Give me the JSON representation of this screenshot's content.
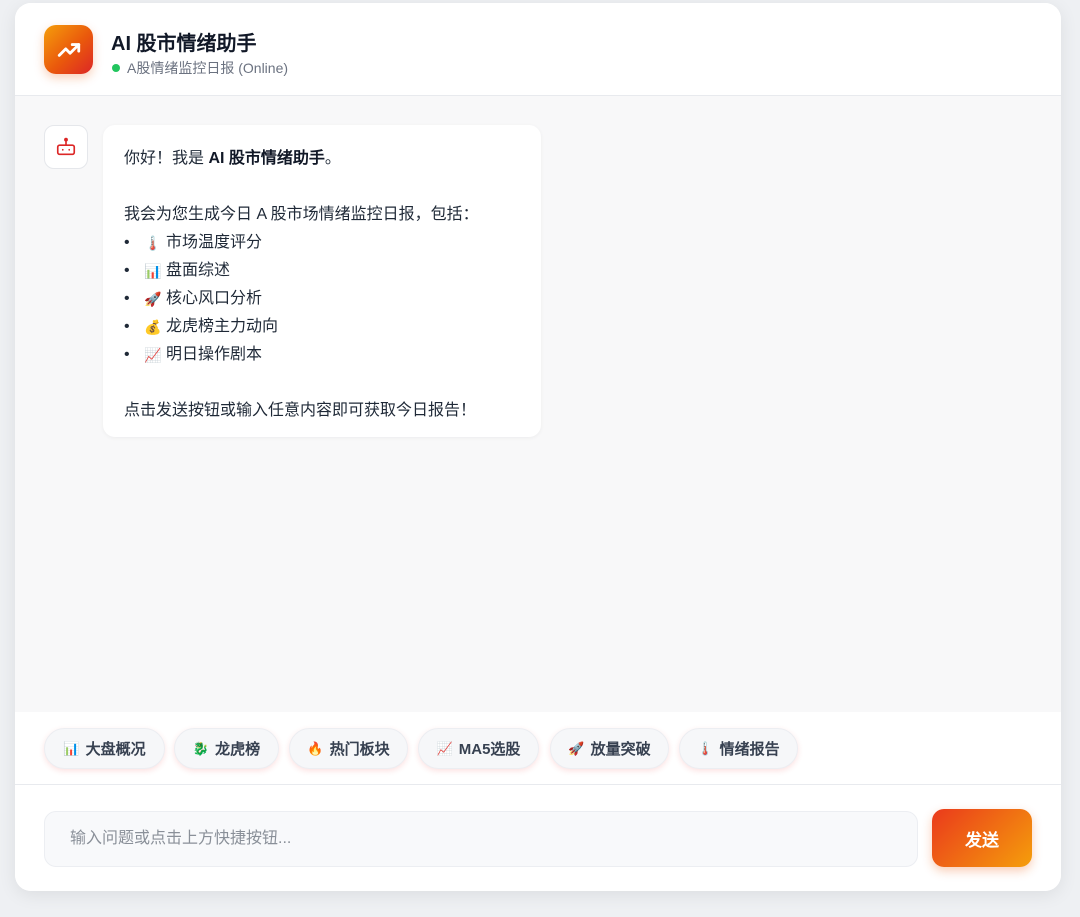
{
  "header": {
    "title": "AI 股市情绪助手",
    "status": "A股情绪监控日报 (Online)",
    "status_color": "#22c55e",
    "logo_icon": "trending-up-icon"
  },
  "message": {
    "avatar_icon": "robot-icon",
    "greeting_prefix": "你好！我是 ",
    "greeting_name": "AI 股市情绪助手",
    "greeting_suffix": "。",
    "intro": "我会为您生成今日 A 股市场情绪监控日报，包括：",
    "items": [
      {
        "bullet": "•",
        "icon": "🌡️",
        "icon_name": "thermometer-icon",
        "label": "市场温度评分"
      },
      {
        "bullet": "•",
        "icon": "📊",
        "icon_name": "bar-chart-icon",
        "label": "盘面综述"
      },
      {
        "bullet": "•",
        "icon": "🚀",
        "icon_name": "rocket-icon",
        "label": "核心风口分析"
      },
      {
        "bullet": "•",
        "icon": "💰",
        "icon_name": "money-bag-icon",
        "label": "龙虎榜主力动向"
      },
      {
        "bullet": "•",
        "icon": "📈",
        "icon_name": "chart-up-icon",
        "label": "明日操作剧本"
      }
    ],
    "outro": "点击发送按钮或输入任意内容即可获取今日报告！"
  },
  "quick_actions": [
    {
      "icon": "📊",
      "icon_name": "bar-chart-icon",
      "label": "大盘概况"
    },
    {
      "icon": "🐉",
      "icon_name": "dragon-icon",
      "label": "龙虎榜"
    },
    {
      "icon": "🔥",
      "icon_name": "fire-icon",
      "label": "热门板块"
    },
    {
      "icon": "📈",
      "icon_name": "chart-up-icon",
      "label": "MA5选股"
    },
    {
      "icon": "🚀",
      "icon_name": "rocket-icon",
      "label": "放量突破"
    },
    {
      "icon": "🌡️",
      "icon_name": "thermometer-icon",
      "label": "情绪报告"
    }
  ],
  "input": {
    "value": "",
    "placeholder": "输入问题或点击上方快捷按钮..."
  },
  "send_label": "发送",
  "colors": {
    "accent_start": "#ea3a1c",
    "accent_end": "#f59e0b"
  }
}
